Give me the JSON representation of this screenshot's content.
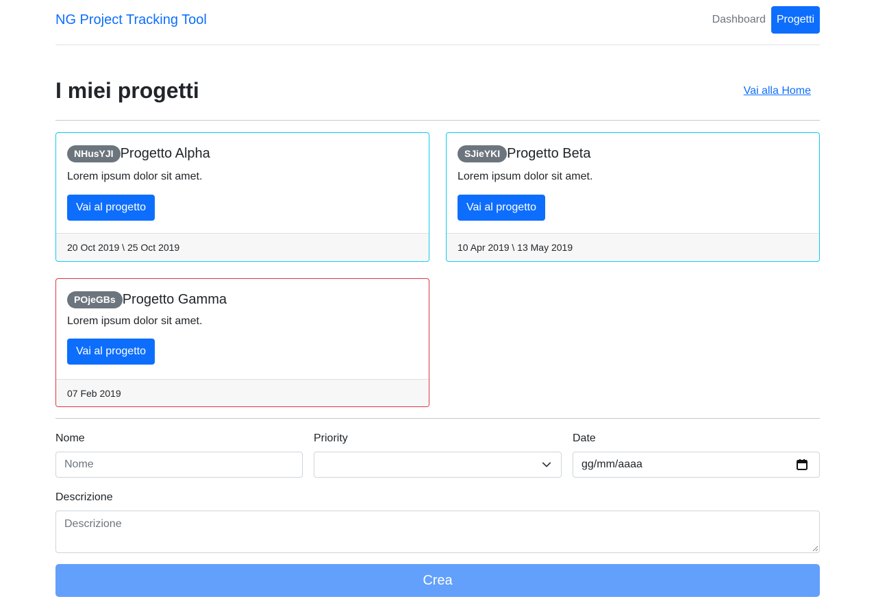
{
  "header": {
    "brand": "NG Project Tracking Tool",
    "nav": [
      {
        "label": "Dashboard",
        "active": false
      },
      {
        "label": "Progetti",
        "active": true
      }
    ]
  },
  "page": {
    "title": "I miei progetti",
    "home_link": "Vai alla Home"
  },
  "projects": [
    {
      "code": "NHusYJI",
      "name": "Progetto Alpha",
      "description": "Lorem ipsum dolor sit amet.",
      "button": "Vai al progetto",
      "dates": "20 Oct 2019 \\ 25 Oct 2019",
      "status_color": "#0dcaf0"
    },
    {
      "code": "SJieYKI",
      "name": "Progetto Beta",
      "description": "Lorem ipsum dolor sit amet.",
      "button": "Vai al progetto",
      "dates": "10 Apr 2019 \\ 13 May 2019",
      "status_color": "#0dcaf0"
    },
    {
      "code": "POjeGBs",
      "name": "Progetto Gamma",
      "description": "Lorem ipsum dolor sit amet.",
      "button": "Vai al progetto",
      "dates": "07 Feb 2019",
      "status_color": "#dc3545"
    }
  ],
  "form": {
    "name_label": "Nome",
    "name_placeholder": "Nome",
    "priority_label": "Priority",
    "priority_value": "",
    "date_label": "Date",
    "date_placeholder": "gg/mm/aaaa",
    "description_label": "Descrizione",
    "description_placeholder": "Descrizione",
    "submit_label": "Crea"
  },
  "colors": {
    "primary": "#0d6efd",
    "submit_disabled": "#62a0fb",
    "badge": "#6c757d"
  }
}
